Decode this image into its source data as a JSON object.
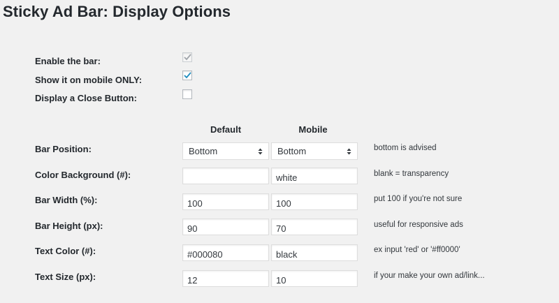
{
  "page": {
    "title": "Sticky Ad Bar: Display Options"
  },
  "toggles": [
    {
      "label": "Enable the bar:",
      "checked": true,
      "disabled": true
    },
    {
      "label": "Show it on mobile ONLY:",
      "checked": true,
      "disabled": false
    },
    {
      "label": "Display a Close Button:",
      "checked": false,
      "disabled": false
    }
  ],
  "columns": {
    "default": "Default",
    "mobile": "Mobile"
  },
  "rows": {
    "position": {
      "label": "Bar Position:",
      "default": "Bottom",
      "mobile": "Bottom",
      "hint": "bottom is advised"
    },
    "color_bg": {
      "label": "Color Background (#):",
      "default": "",
      "mobile": "white",
      "hint": "blank = transparency"
    },
    "width": {
      "label": "Bar Width (%):",
      "default": "100",
      "mobile": "100",
      "hint": "put 100 if you're not sure"
    },
    "height": {
      "label": "Bar Height (px):",
      "default": "90",
      "mobile": "70",
      "hint": "useful for responsive ads"
    },
    "text_color": {
      "label": "Text Color (#):",
      "default": "#000080",
      "mobile": "black",
      "hint": "ex input 'red' or '#ff0000'"
    },
    "text_size": {
      "label": "Text Size (px):",
      "default": "12",
      "mobile": "10",
      "hint": "if your make your own ad/link..."
    }
  },
  "colors": {
    "checkmark": "#1e8cbe",
    "checkmark_disabled": "#a0a5aa"
  }
}
